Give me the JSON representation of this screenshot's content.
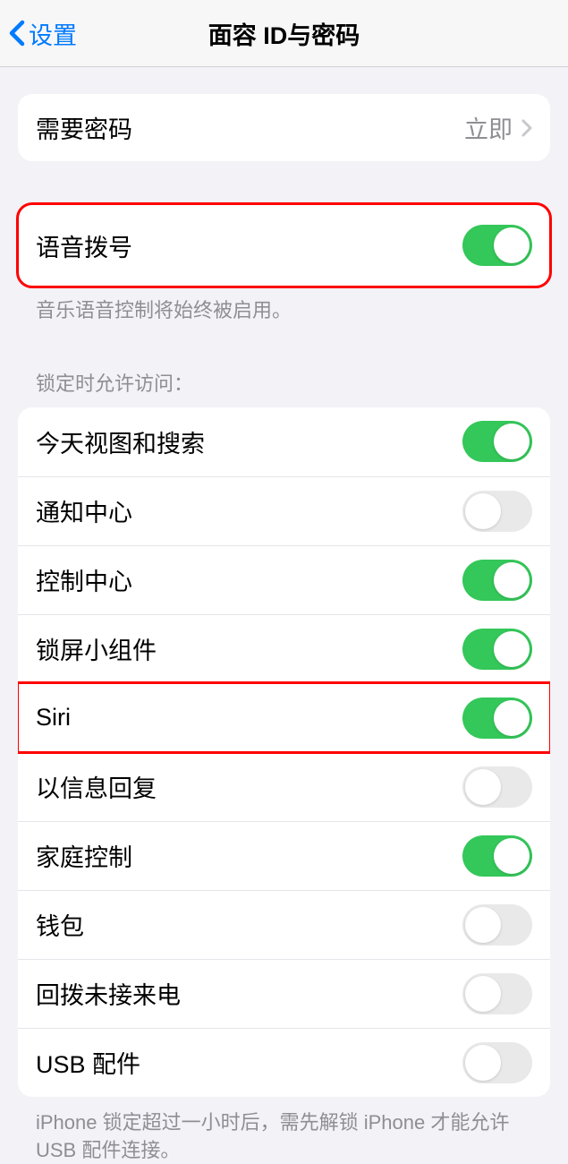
{
  "nav": {
    "back": "设置",
    "title": "面容 ID与密码"
  },
  "require_passcode": {
    "label": "需要密码",
    "value": "立即"
  },
  "voice_dial": {
    "label": "语音拨号",
    "on": true,
    "footer": "音乐语音控制将始终被启用。"
  },
  "lock_access": {
    "header": "锁定时允许访问：",
    "items": [
      {
        "label": "今天视图和搜索",
        "on": true
      },
      {
        "label": "通知中心",
        "on": false
      },
      {
        "label": "控制中心",
        "on": true
      },
      {
        "label": "锁屏小组件",
        "on": true
      },
      {
        "label": "Siri",
        "on": true
      },
      {
        "label": "以信息回复",
        "on": false
      },
      {
        "label": "家庭控制",
        "on": true
      },
      {
        "label": "钱包",
        "on": false
      },
      {
        "label": "回拨未接来电",
        "on": false
      },
      {
        "label": "USB 配件",
        "on": false
      }
    ],
    "footer": "iPhone 锁定超过一小时后，需先解锁 iPhone 才能允许USB 配件连接。"
  },
  "highlights": {
    "voice_dial": true,
    "siri_index": 4
  }
}
